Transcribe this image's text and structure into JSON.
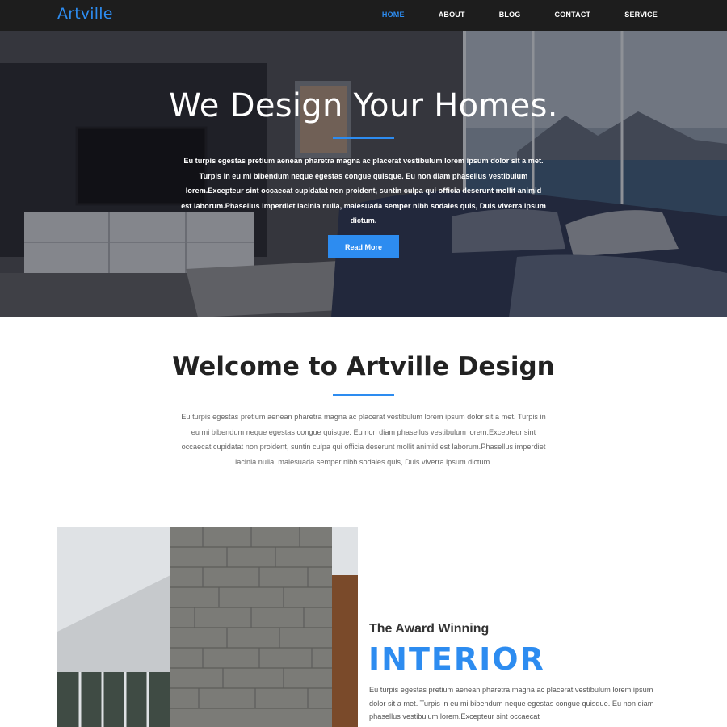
{
  "nav": {
    "brand": "Artville",
    "links": [
      "HOME",
      "ABOUT",
      "BLOG",
      "CONTACT",
      "SERVICE"
    ],
    "active": "HOME"
  },
  "hero": {
    "title": "We Design Your Homes.",
    "text": "Eu turpis egestas pretium aenean pharetra magna ac placerat vestibulum lorem ipsum dolor sit a met. Turpis in eu mi bibendum neque egestas congue quisque. Eu non diam phasellus vestibulum lorem.Excepteur sint occaecat cupidatat non proident, suntin culpa qui officia deserunt mollit animid est laborum.Phasellus imperdiet lacinia nulla, malesuada semper nibh sodales quis, Duis viverra ipsum dictum.",
    "button": "Read More"
  },
  "welcome": {
    "title": "Welcome to Artville Design",
    "text": "Eu turpis egestas pretium aenean pharetra magna ac placerat vestibulum lorem ipsum dolor sit a met. Turpis in eu mi bibendum neque egestas congue quisque. Eu non diam phasellus vestibulum lorem.Excepteur sint occaecat cupidatat non proident, suntin culpa qui officia deserunt mollit animid est laborum.Phasellus imperdiet lacinia nulla, malesuada semper nibh sodales quis, Duis viverra ipsum dictum."
  },
  "feature": {
    "subtitle": "The Award Winning",
    "title": "INTERIOR",
    "text": "Eu turpis egestas pretium aenean pharetra magna ac placerat vestibulum lorem ipsum dolor sit a met. Turpis in eu mi bibendum neque egestas congue quisque. Eu non diam phasellus vestibulum lorem.Excepteur sint occaecat"
  },
  "colors": {
    "accent": "#2d8cf0",
    "navbar": "#1d1d1d"
  }
}
